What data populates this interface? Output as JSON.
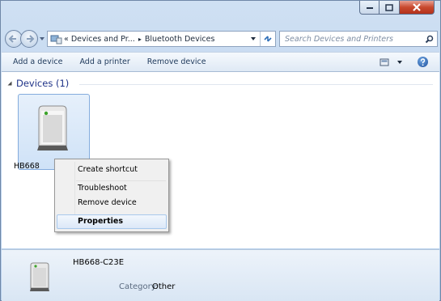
{
  "breadcrumb": {
    "prefix": "«",
    "segment1": "Devices and Pr...",
    "separator": "▸",
    "segment2": "Bluetooth Devices"
  },
  "search": {
    "placeholder": "Search Devices and Printers"
  },
  "toolbar": {
    "add_device": "Add a device",
    "add_printer": "Add a printer",
    "remove_device": "Remove device"
  },
  "group": {
    "label": "Devices (1)"
  },
  "device": {
    "tile_label": "HB668",
    "name": "HB668-C23E",
    "category_label": "Category:",
    "category_value": "Other"
  },
  "context_menu": {
    "create_shortcut": "Create shortcut",
    "troubleshoot": "Troubleshoot",
    "remove_device": "Remove device",
    "properties": "Properties"
  },
  "colors": {
    "accent": "#3c7fb1",
    "header_blue": "#1e3287",
    "close_red": "#c8492e"
  }
}
